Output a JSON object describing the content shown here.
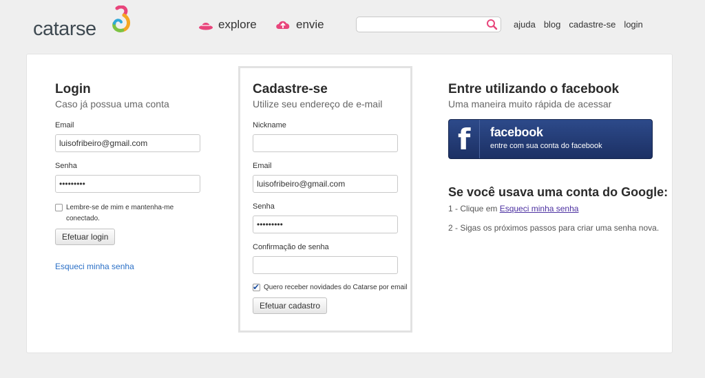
{
  "header": {
    "logo_text": "catarse",
    "nav": {
      "explore": "explore",
      "envie": "envie"
    },
    "search": {
      "placeholder": "",
      "value": ""
    },
    "links": [
      "ajuda",
      "blog",
      "cadastre-se",
      "login"
    ],
    "brand_pink": "#e8457b"
  },
  "login": {
    "title": "Login",
    "subtitle": "Caso já possua uma conta",
    "email_label": "Email",
    "email_value": "luisofribeiro@gmail.com",
    "password_label": "Senha",
    "password_value": "•••••••••",
    "remember_label": "Lembre-se de mim e mantenha-me conectado.",
    "remember_checked": false,
    "submit_label": "Efetuar login",
    "forgot_label": "Esqueci minha senha"
  },
  "signup": {
    "title": "Cadastre-se",
    "subtitle": "Utilize seu endereço de e-mail",
    "nickname_label": "Nickname",
    "nickname_value": "",
    "email_label": "Email",
    "email_value": "luisofribeiro@gmail.com",
    "password_label": "Senha",
    "password_value": "•••••••••",
    "confirm_label": "Confirmação de senha",
    "confirm_value": "",
    "newsletter_label": "Quero receber novidades do Catarse por email",
    "newsletter_checked": true,
    "submit_label": "Efetuar cadastro"
  },
  "facebook": {
    "title": "Entre utilizando o facebook",
    "subtitle": "Uma maneira muito rápida de acessar",
    "button_logo": "f",
    "button_title": "facebook",
    "button_sub": "entre com sua conta do facebook",
    "google_title": "Se você usava uma conta do Google:",
    "step1_prefix": "1 - Clique em ",
    "step1_link": "Esqueci minha senha",
    "step2": "2 - Sigas os próximos passos para criar uma senha nova."
  }
}
